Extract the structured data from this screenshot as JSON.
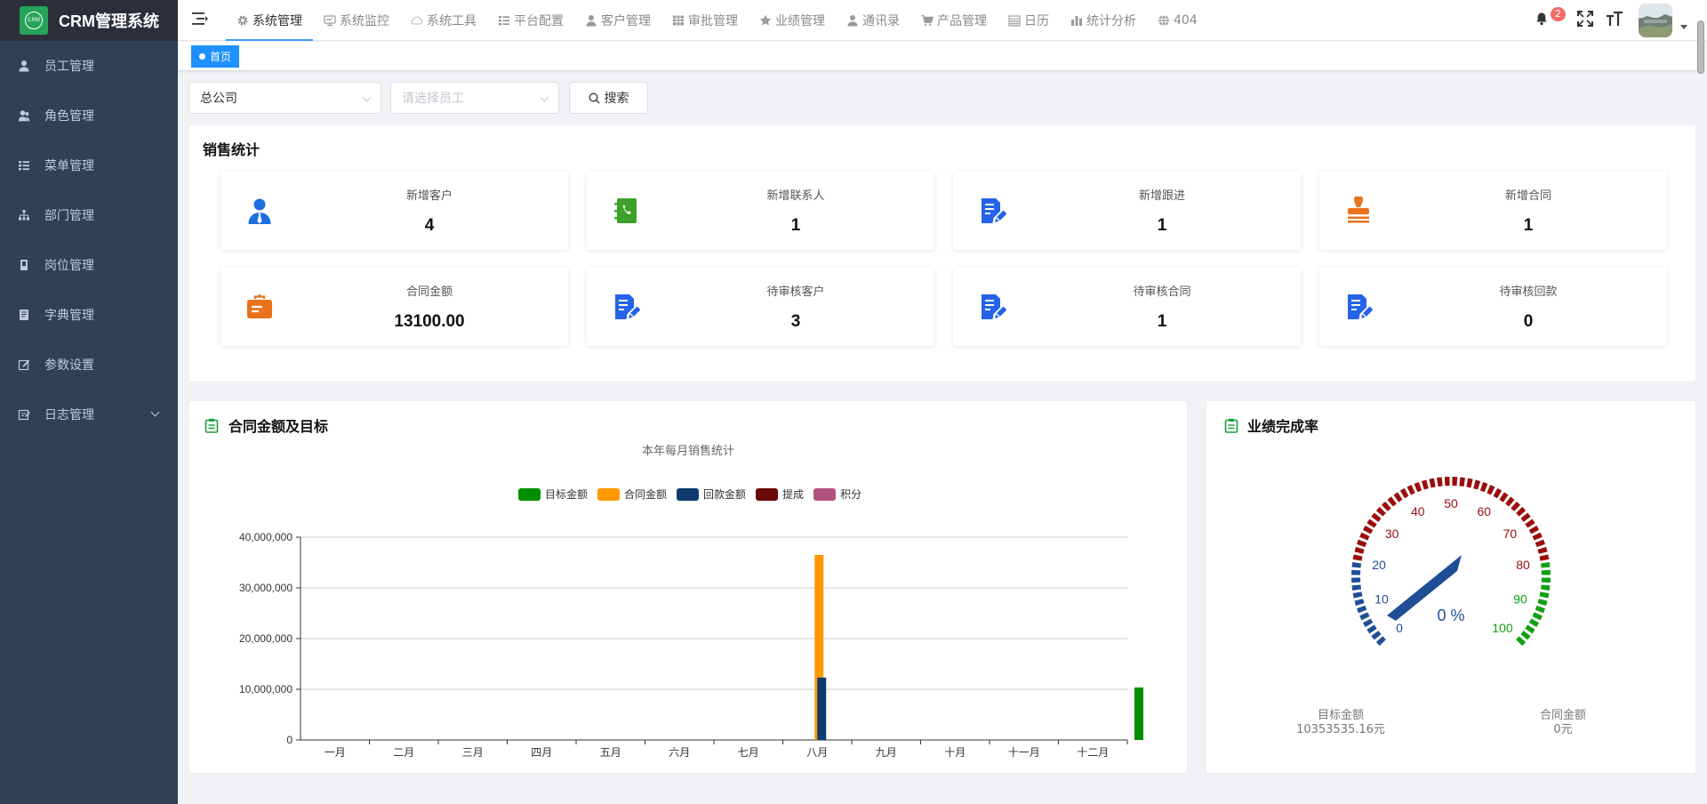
{
  "app": {
    "title": "CRM管理系统",
    "logo_text": "CRM"
  },
  "sidebar": {
    "items": [
      {
        "label": "员工管理",
        "icon": "user-icon"
      },
      {
        "label": "角色管理",
        "icon": "users-icon"
      },
      {
        "label": "菜单管理",
        "icon": "list-icon"
      },
      {
        "label": "部门管理",
        "icon": "org-tree-icon"
      },
      {
        "label": "岗位管理",
        "icon": "post-icon"
      },
      {
        "label": "字典管理",
        "icon": "dict-icon"
      },
      {
        "label": "参数设置",
        "icon": "edit-icon"
      },
      {
        "label": "日志管理",
        "icon": "log-icon",
        "expandable": true
      }
    ]
  },
  "topnav": {
    "tabs": [
      {
        "label": "系统管理",
        "icon": "gear-icon",
        "active": true
      },
      {
        "label": "系统监控",
        "icon": "monitor-icon"
      },
      {
        "label": "系统工具",
        "icon": "cloud-icon"
      },
      {
        "label": "平台配置",
        "icon": "list-icon"
      },
      {
        "label": "客户管理",
        "icon": "user-icon"
      },
      {
        "label": "审批管理",
        "icon": "table-icon"
      },
      {
        "label": "业绩管理",
        "icon": "star-icon"
      },
      {
        "label": "通讯录",
        "icon": "user-icon"
      },
      {
        "label": "产品管理",
        "icon": "cart-icon"
      },
      {
        "label": "日历",
        "icon": "calendar-icon"
      },
      {
        "label": "统计分析",
        "icon": "bar-chart-icon"
      },
      {
        "label": "404",
        "icon": "globe-icon"
      }
    ],
    "notification_count": "2"
  },
  "tags": {
    "home": "首页"
  },
  "filters": {
    "company_value": "总公司",
    "employee_placeholder": "请选择员工",
    "search_label": "搜索"
  },
  "sales_stats": {
    "title": "销售统计",
    "cards": [
      {
        "label": "新增客户",
        "value": "4",
        "icon": "customer-icon",
        "color": "#1f6fe0"
      },
      {
        "label": "新增联系人",
        "value": "1",
        "icon": "contact-book-icon",
        "color": "#3ea02b"
      },
      {
        "label": "新增跟进",
        "value": "1",
        "icon": "document-edit-icon",
        "color": "#2563eb"
      },
      {
        "label": "新增合同",
        "value": "1",
        "icon": "stamp-icon",
        "color": "#e8731c"
      },
      {
        "label": "合同金额",
        "value": "13100.00",
        "icon": "briefcase-icon",
        "color": "#e8731c"
      },
      {
        "label": "待审核客户",
        "value": "3",
        "icon": "document-edit-icon",
        "color": "#2563eb"
      },
      {
        "label": "待审核合同",
        "value": "1",
        "icon": "document-edit-icon",
        "color": "#2563eb"
      },
      {
        "label": "待审核回款",
        "value": "0",
        "icon": "document-edit-icon",
        "color": "#2563eb"
      }
    ]
  },
  "contract_panel": {
    "title": "合同金额及目标"
  },
  "performance_panel": {
    "title": "业绩完成率",
    "target_label": "目标金额",
    "target_value": "10353535.16元",
    "contract_label": "合同金额",
    "contract_value": "0元"
  },
  "chart_data": [
    {
      "type": "bar",
      "title": "本年每月销售统计",
      "categories": [
        "一月",
        "二月",
        "三月",
        "四月",
        "五月",
        "六月",
        "七月",
        "八月",
        "九月",
        "十月",
        "十一月",
        "十二月"
      ],
      "series": [
        {
          "name": "目标金额",
          "color": "#008f00",
          "values": [
            0,
            0,
            0,
            0,
            0,
            0,
            0,
            0,
            0,
            0,
            0,
            0
          ]
        },
        {
          "name": "合同金额",
          "color": "#ff9900",
          "values": [
            0,
            0,
            0,
            0,
            0,
            0,
            0,
            36500000,
            0,
            0,
            0,
            0
          ]
        },
        {
          "name": "回款金额",
          "color": "#0d3b6e",
          "values": [
            0,
            0,
            0,
            0,
            0,
            0,
            0,
            12300000,
            0,
            0,
            0,
            0
          ]
        },
        {
          "name": "提成",
          "color": "#6b0a0a",
          "values": [
            0,
            0,
            0,
            0,
            0,
            0,
            0,
            0,
            0,
            0,
            0,
            0
          ]
        },
        {
          "name": "积分",
          "color": "#b2527f",
          "values": [
            0,
            0,
            0,
            0,
            0,
            0,
            0,
            0,
            0,
            0,
            0,
            0
          ]
        }
      ],
      "extra_bar": {
        "series": "目标金额",
        "value": 10353535
      },
      "ylim": [
        0,
        40000000
      ],
      "yticks": [
        "0",
        "10,000,000",
        "20,000,000",
        "30,000,000",
        "40,000,000"
      ],
      "grid": true,
      "legend": "top-center"
    },
    {
      "type": "gauge",
      "min": 0,
      "max": 100,
      "value": 0,
      "display": "0 %",
      "tick_labels": [
        "0",
        "10",
        "20",
        "30",
        "40",
        "50",
        "60",
        "70",
        "80",
        "90",
        "100"
      ],
      "bands": [
        {
          "to": 0.2,
          "color": "#1f4e96"
        },
        {
          "to": 0.8,
          "color": "#9b0d0d"
        },
        {
          "to": 1.0,
          "color": "#11a012"
        }
      ]
    }
  ]
}
